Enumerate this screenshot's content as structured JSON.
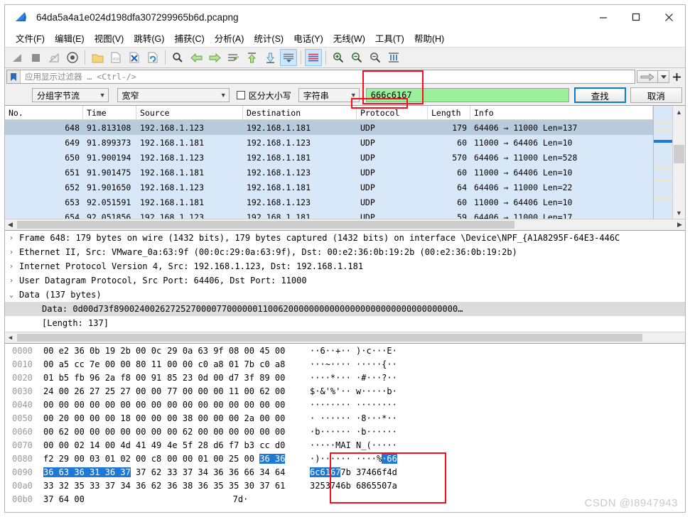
{
  "window": {
    "title": "64da5a4a1e024d198dfa307299965b6d.pcapng",
    "app_icon": "wireshark-shark-fin-icon",
    "minimize": "—",
    "maximize": "□",
    "close": "✕"
  },
  "menubar": [
    {
      "label": "文件(F)",
      "name": "menu-file"
    },
    {
      "label": "编辑(E)",
      "name": "menu-edit"
    },
    {
      "label": "视图(V)",
      "name": "menu-view"
    },
    {
      "label": "跳转(G)",
      "name": "menu-go"
    },
    {
      "label": "捕获(C)",
      "name": "menu-capture"
    },
    {
      "label": "分析(A)",
      "name": "menu-analyze"
    },
    {
      "label": "统计(S)",
      "name": "menu-statistics"
    },
    {
      "label": "电话(Y)",
      "name": "menu-telephony"
    },
    {
      "label": "无线(W)",
      "name": "menu-wireless"
    },
    {
      "label": "工具(T)",
      "name": "menu-tools"
    },
    {
      "label": "帮助(H)",
      "name": "menu-help"
    }
  ],
  "toolbar": {
    "icons": [
      "start-capture-icon",
      "stop-capture-icon",
      "restart-capture-icon",
      "capture-options-icon",
      "open-file-icon",
      "save-file-icon",
      "close-file-icon",
      "reload-file-icon",
      "find-packet-icon",
      "go-back-icon",
      "go-forward-icon",
      "go-to-packet-icon",
      "go-first-packet-icon",
      "go-last-packet-icon",
      "auto-scroll-icon",
      "colorize-icon",
      "zoom-in-icon",
      "zoom-out-icon",
      "zoom-reset-icon",
      "resize-columns-icon"
    ]
  },
  "filter": {
    "bookmark_icon": "bookmark-icon",
    "placeholder": "应用显示过滤器 … <Ctrl-/>",
    "value": "",
    "apply_icon": "arrow-right-icon",
    "dropdown_icon": "chevron-down-icon",
    "add_icon": "plus-icon"
  },
  "findbar": {
    "search_in": "分组字节流",
    "narrow_wide": "宽窄",
    "case_label": "区分大小写",
    "case_checked": false,
    "value_type": "字符串",
    "query": "666c6167",
    "find_button": "查找",
    "cancel_button": "取消"
  },
  "packet_list": {
    "columns": [
      {
        "label": "No.",
        "name": "column-no"
      },
      {
        "label": "Time",
        "name": "column-time"
      },
      {
        "label": "Source",
        "name": "column-source"
      },
      {
        "label": "Destination",
        "name": "column-destination"
      },
      {
        "label": "Protocol",
        "name": "column-protocol"
      },
      {
        "label": "Length",
        "name": "column-length"
      },
      {
        "label": "Info",
        "name": "column-info"
      }
    ],
    "rows": [
      {
        "no": "648",
        "time": "91.813108",
        "src": "192.168.1.123",
        "dst": "192.168.1.181",
        "proto": "UDP",
        "len": "179",
        "info": "64406 → 11000 Len=137",
        "selected": true
      },
      {
        "no": "649",
        "time": "91.899373",
        "src": "192.168.1.181",
        "dst": "192.168.1.123",
        "proto": "UDP",
        "len": "60",
        "info": "11000 → 64406 Len=10",
        "selected": false
      },
      {
        "no": "650",
        "time": "91.900194",
        "src": "192.168.1.123",
        "dst": "192.168.1.181",
        "proto": "UDP",
        "len": "570",
        "info": "64406 → 11000 Len=528",
        "selected": false
      },
      {
        "no": "651",
        "time": "91.901475",
        "src": "192.168.1.181",
        "dst": "192.168.1.123",
        "proto": "UDP",
        "len": "60",
        "info": "11000 → 64406 Len=10",
        "selected": false
      },
      {
        "no": "652",
        "time": "91.901650",
        "src": "192.168.1.123",
        "dst": "192.168.1.181",
        "proto": "UDP",
        "len": "64",
        "info": "64406 → 11000 Len=22",
        "selected": false
      },
      {
        "no": "653",
        "time": "92.051591",
        "src": "192.168.1.181",
        "dst": "192.168.1.123",
        "proto": "UDP",
        "len": "60",
        "info": "11000 → 64406 Len=10",
        "selected": false
      },
      {
        "no": "654",
        "time": "92.051856",
        "src": "192.168.1.123",
        "dst": "192.168.1.181",
        "proto": "UDP",
        "len": "59",
        "info": "64406 → 11000 Len=17",
        "selected": false
      }
    ]
  },
  "detail_tree": [
    {
      "twisty": "›",
      "text": "Frame 648: 179 bytes on wire (1432 bits), 179 bytes captured (1432 bits) on interface \\Device\\NPF_{A1A8295F-64E3-446C",
      "indent": 0,
      "highlight": false
    },
    {
      "twisty": "›",
      "text": "Ethernet II, Src: VMware_0a:63:9f (00:0c:29:0a:63:9f), Dst: 00:e2:36:0b:19:2b (00:e2:36:0b:19:2b)",
      "indent": 0,
      "highlight": false
    },
    {
      "twisty": "›",
      "text": "Internet Protocol Version 4, Src: 192.168.1.123, Dst: 192.168.1.181",
      "indent": 0,
      "highlight": false
    },
    {
      "twisty": "›",
      "text": "User Datagram Protocol, Src Port: 64406, Dst Port: 11000",
      "indent": 0,
      "highlight": false
    },
    {
      "twisty": "⌄",
      "text": "Data (137 bytes)",
      "indent": 0,
      "highlight": false
    },
    {
      "twisty": "",
      "text": "Data: 0d00d73f8900240026272527000077000000110062000000000000000000000000000000000…",
      "indent": 1,
      "highlight": true
    },
    {
      "twisty": "",
      "text": "[Length: 137]",
      "indent": 1,
      "highlight": false
    }
  ],
  "hex_dump": [
    {
      "offset": "0000",
      "hex_left": "00 e2 36 0b 19 2b 00 0c",
      "hex_right": "29 0a 63 9f 08 00 45 00",
      "ascii": "··6··+·· )·c···E·"
    },
    {
      "offset": "0010",
      "hex_left": "00 a5 cc 7e 00 00 80 11",
      "hex_right": "00 00 c0 a8 01 7b c0 a8",
      "ascii": "···~···· ·····{··"
    },
    {
      "offset": "0020",
      "hex_left": "01 b5 fb 96 2a f8 00 91",
      "hex_right": "85 23 0d 00 d7 3f 89 00",
      "ascii": "····*··· ·#···?··"
    },
    {
      "offset": "0030",
      "hex_left": "24 00 26 27 25 27 00 00",
      "hex_right": "77 00 00 00 11 00 62 00",
      "ascii": "$·&'%'·· w·····b·"
    },
    {
      "offset": "0040",
      "hex_left": "00 00 00 00 00 00 00 00",
      "hex_right": "00 00 00 00 00 00 00 00",
      "ascii": "········ ········"
    },
    {
      "offset": "0050",
      "hex_left": "00 20 00 00 00 18 00 00",
      "hex_right": "00 38 00 00 00 2a 00 00",
      "ascii": "· ······ ·8···*··"
    },
    {
      "offset": "0060",
      "hex_left": "00 62 00 00 00 00 00 00",
      "hex_right": "00 62 00 00 00 00 00 00",
      "ascii": "·b······ ·b······"
    },
    {
      "offset": "0070",
      "hex_left": "00 00 02 14 00 4d 41 49",
      "hex_right": "4e 5f 28 d6 f7 b3 cc d0",
      "ascii": "·····MAI N_(·····"
    },
    {
      "offset": "0080",
      "hex_left": "f2 29 00 03 01 02 00 c8",
      "hex_right": "00 00 01 00 25 00 36 36",
      "ascii": "·)······ ····%·66",
      "hl_hex_right_from": 6,
      "hl_ascii_from": 14
    },
    {
      "offset": "0090",
      "hex_left": "36 63 36 31 36 37 37 62",
      "hex_right": "33 37 34 36 36 66 34 64",
      "ascii": "6c61677b 37466f4d",
      "hl_hex_left_to": 6,
      "hl_ascii_to": 6
    },
    {
      "offset": "00a0",
      "hex_left": "33 32 35 33 37 34 36 62",
      "hex_right": "36 38 36 35 35 30 37 61",
      "ascii": "3253746b 6865507a"
    },
    {
      "offset": "00b0",
      "hex_left": "37 64 00",
      "hex_right": "",
      "ascii": "7d·"
    }
  ],
  "annotations": {
    "red_box_search": "red-highlight-search-field",
    "red_box_ascii": "red-highlight-ascii-flag"
  },
  "watermark": "CSDN @I8947943"
}
